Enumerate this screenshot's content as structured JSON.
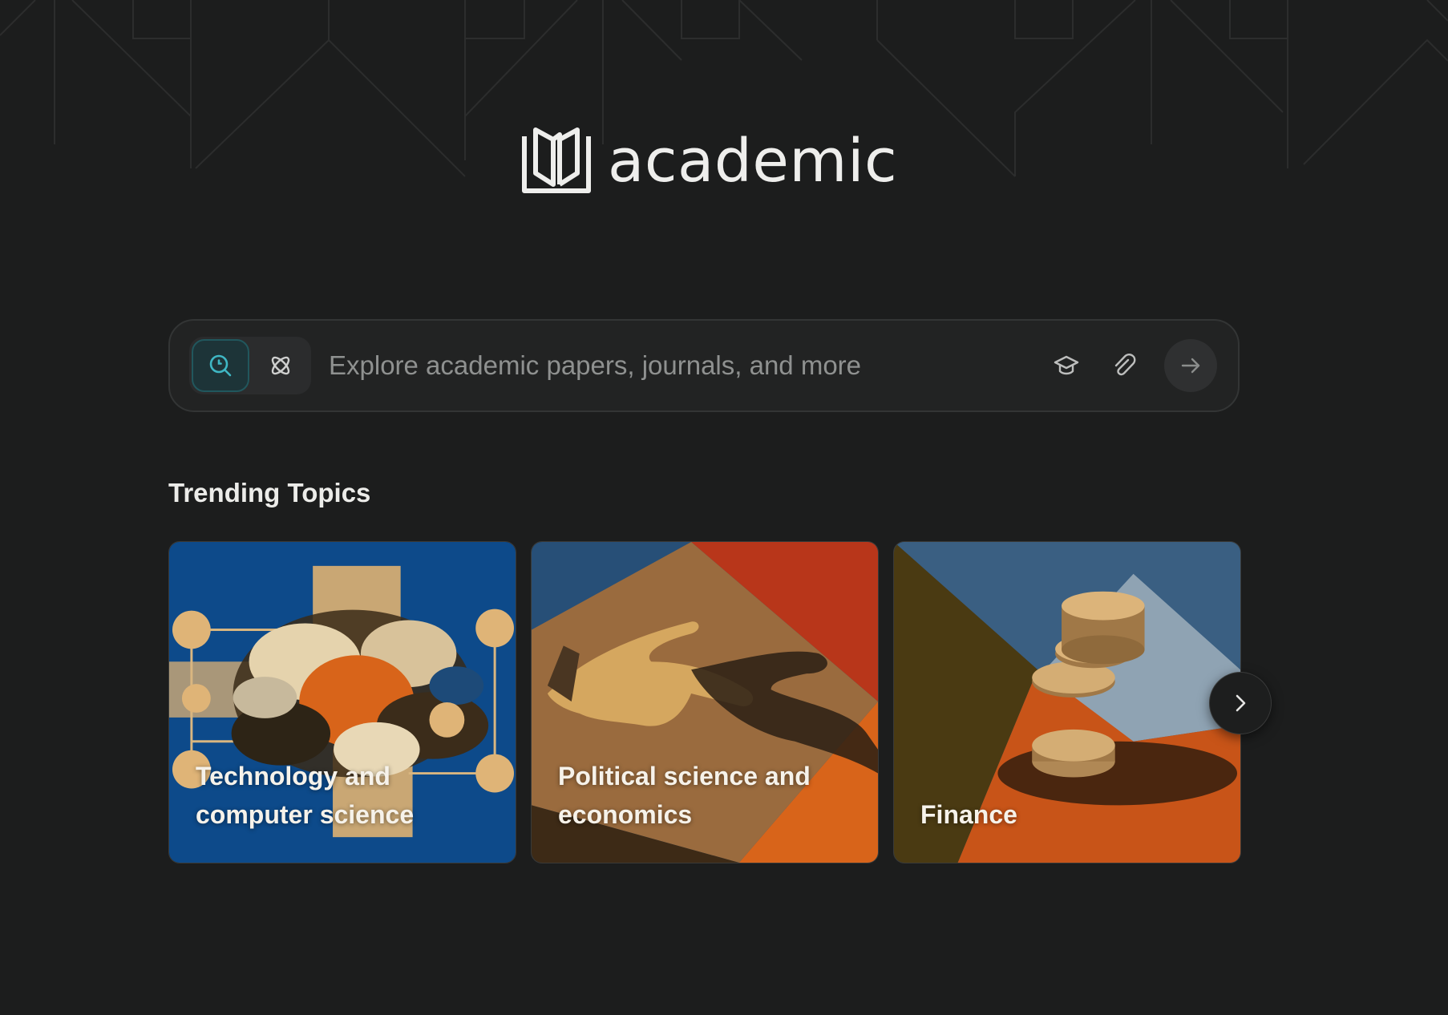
{
  "app": {
    "brand": "academic"
  },
  "search": {
    "placeholder": "Explore academic papers, journals, and more",
    "modes": [
      {
        "icon": "search-icon",
        "active": true
      },
      {
        "icon": "atom-icon",
        "active": false
      }
    ],
    "actions": [
      {
        "icon": "graduation-cap-icon"
      },
      {
        "icon": "paperclip-icon"
      },
      {
        "icon": "arrow-right-icon"
      }
    ]
  },
  "trending": {
    "title": "Trending Topics",
    "cards": [
      {
        "label": "Technology and computer science"
      },
      {
        "label": "Political science and economics"
      },
      {
        "label": "Finance"
      }
    ],
    "next_icon": "chevron-right-icon"
  },
  "colors": {
    "background": "#1c1d1d",
    "accent": "#3fa7b4",
    "card_blue": "#0d4a8a",
    "card_orange": "#d8641a"
  }
}
